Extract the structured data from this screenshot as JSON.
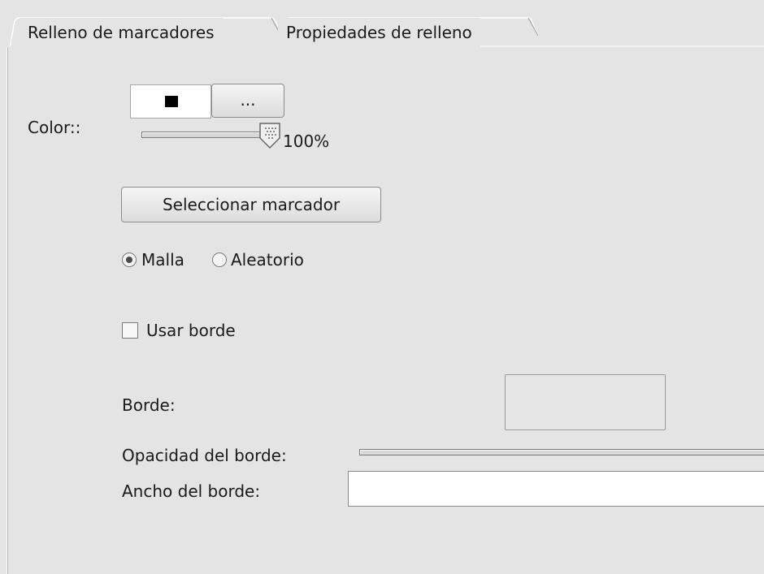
{
  "tabs": [
    {
      "label": "Relleno de marcadores",
      "active": true
    },
    {
      "label": "Propiedades de relleno",
      "active": false
    }
  ],
  "color": {
    "label": "Color::",
    "swatch_color": "#000000",
    "picker_button_label": "...",
    "opacity_value": "100%",
    "opacity_fraction": 1.0
  },
  "select_marker_button_label": "Seleccionar marcador",
  "distribution": {
    "options": [
      {
        "label": "Malla",
        "selected": true
      },
      {
        "label": "Aleatorio",
        "selected": false
      }
    ]
  },
  "use_border": {
    "label": "Usar borde",
    "checked": false
  },
  "border": {
    "color_label": "Borde:",
    "opacity_label": "Opacidad del borde:",
    "width_label": "Ancho del borde:",
    "width_value": ""
  }
}
